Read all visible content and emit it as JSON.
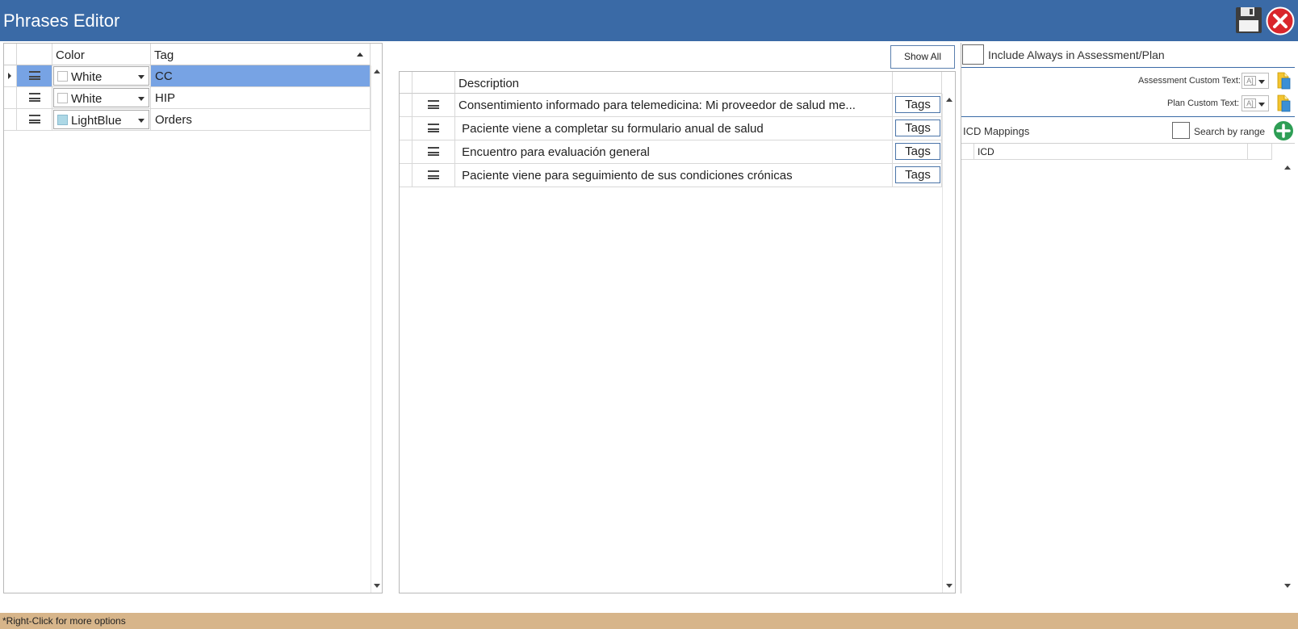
{
  "window": {
    "title": "Phrases Editor"
  },
  "toolbar": {
    "save_icon": "save-icon",
    "close_icon": "close-icon"
  },
  "tags_grid": {
    "headers": {
      "color": "Color",
      "tag": "Tag"
    },
    "rows": [
      {
        "color": "White",
        "swatch": "#ffffff",
        "tag": "CC",
        "selected": true
      },
      {
        "color": "White",
        "swatch": "#ffffff",
        "tag": "HIP",
        "selected": false
      },
      {
        "color": "LightBlue",
        "swatch": "#add8e6",
        "tag": "Orders",
        "selected": false
      }
    ]
  },
  "phrases": {
    "show_all_label": "Show All",
    "headers": {
      "description": "Description"
    },
    "tags_label": "Tags",
    "rows": [
      {
        "description": "Consentimiento informado para telemedicina:  Mi proveedor de salud me..."
      },
      {
        "description": " Paciente viene a completar su formulario anual de salud"
      },
      {
        "description": " Encuentro para evaluación general"
      },
      {
        "description": " Paciente viene para seguimiento de sus condiciones crónicas"
      }
    ]
  },
  "settings": {
    "include_always_label": "Include Always in Assessment/Plan",
    "assessment_custom_text_label": "Assessment Custom Text:",
    "plan_custom_text_label": "Plan Custom Text:",
    "icd_mappings_label": "ICD Mappings",
    "search_by_range_label": "Search by range",
    "icd_header": "ICD"
  },
  "footer": {
    "hint": "*Right-Click for more options"
  },
  "colors": {
    "titlebar": "#3a6aa6",
    "selection": "#77a3e4",
    "footer": "#d7b58a",
    "add": "#2e9e55"
  }
}
